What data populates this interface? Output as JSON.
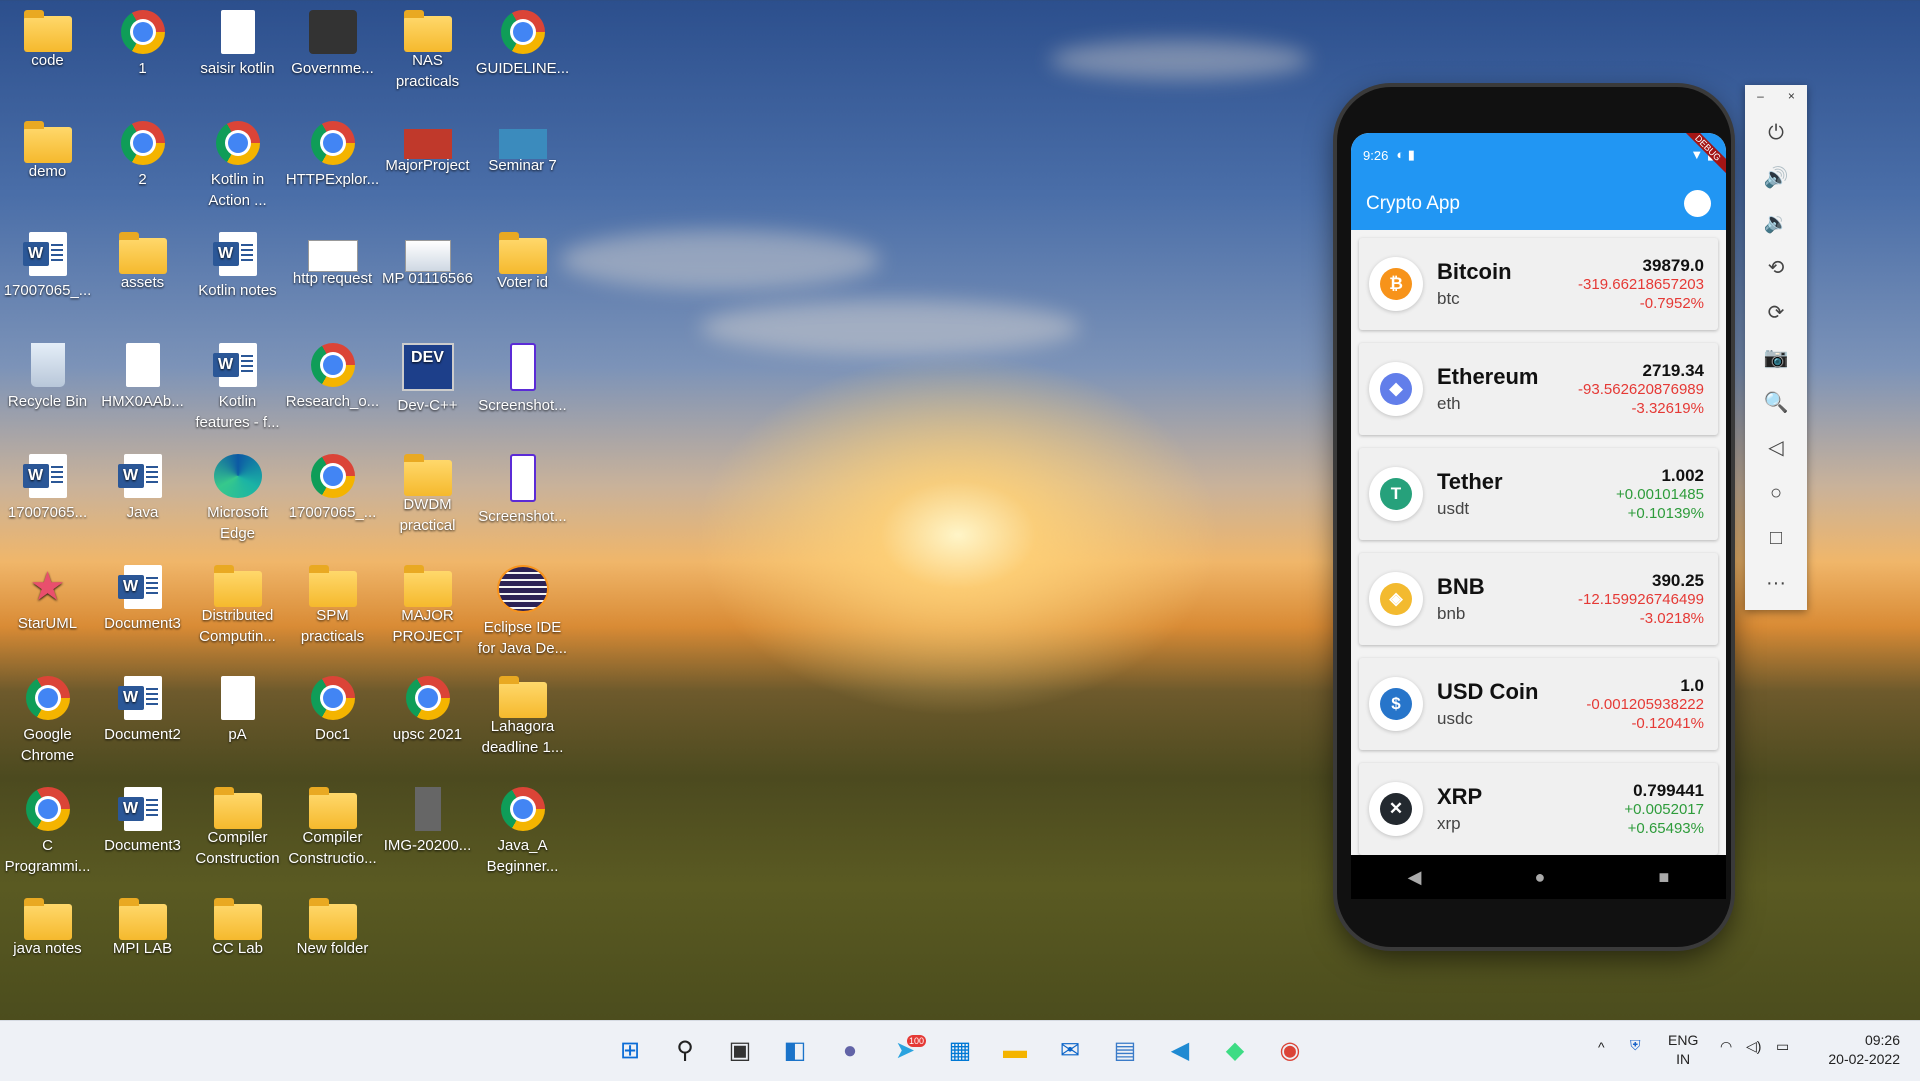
{
  "desktop": {
    "icons": [
      {
        "label": "code",
        "type": "folder"
      },
      {
        "label": "1",
        "type": "chrome"
      },
      {
        "label": "saisir kotlin",
        "type": "doc"
      },
      {
        "label": "Governme...",
        "type": "gov"
      },
      {
        "label": "NAS practicals",
        "type": "folder"
      },
      {
        "label": "GUIDELINE...",
        "type": "chrome"
      },
      {
        "label": "demo",
        "type": "folder"
      },
      {
        "label": "2",
        "type": "chrome"
      },
      {
        "label": "Kotlin in Action ...",
        "type": "chrome"
      },
      {
        "label": "HTTPExplor...",
        "type": "chrome"
      },
      {
        "label": "MajorProject",
        "type": "major"
      },
      {
        "label": "Seminar 7",
        "type": "seminar"
      },
      {
        "label": "17007065_...",
        "type": "word"
      },
      {
        "label": "assets",
        "type": "folder"
      },
      {
        "label": "Kotlin notes",
        "type": "word"
      },
      {
        "label": "http request",
        "type": "http"
      },
      {
        "label": "MP 01116566",
        "type": "img"
      },
      {
        "label": "Voter id",
        "type": "folder"
      },
      {
        "label": "Recycle Bin",
        "type": "bin"
      },
      {
        "label": "HMX0AAb...",
        "type": "doc"
      },
      {
        "label": "Kotlin features - f...",
        "type": "word"
      },
      {
        "label": "Research_o...",
        "type": "chrome"
      },
      {
        "label": "Dev-C++",
        "type": "dev"
      },
      {
        "label": "Screenshot...",
        "type": "phone"
      },
      {
        "label": "17007065...",
        "type": "word"
      },
      {
        "label": "Java",
        "type": "word"
      },
      {
        "label": "Microsoft Edge",
        "type": "edge"
      },
      {
        "label": "17007065_...",
        "type": "chrome"
      },
      {
        "label": "DWDM practical",
        "type": "folder"
      },
      {
        "label": "Screenshot...",
        "type": "phone"
      },
      {
        "label": "StarUML",
        "type": "star"
      },
      {
        "label": "Document3",
        "type": "word"
      },
      {
        "label": "Distributed Computin...",
        "type": "folder"
      },
      {
        "label": "SPM practicals",
        "type": "folder"
      },
      {
        "label": "MAJOR PROJECT",
        "type": "folder"
      },
      {
        "label": "Eclipse IDE for Java De...",
        "type": "eclipse"
      },
      {
        "label": "Google Chrome",
        "type": "chrome"
      },
      {
        "label": "Document2",
        "type": "word"
      },
      {
        "label": "pA",
        "type": "doc"
      },
      {
        "label": "Doc1",
        "type": "chrome"
      },
      {
        "label": "upsc 2021",
        "type": "chrome"
      },
      {
        "label": "Lahagora deadline 1...",
        "type": "folder"
      },
      {
        "label": "C Programmi...",
        "type": "chrome"
      },
      {
        "label": "Document3",
        "type": "word"
      },
      {
        "label": "Compiler Construction",
        "type": "folder"
      },
      {
        "label": "Compiler Constructio...",
        "type": "folder"
      },
      {
        "label": "IMG-20200...",
        "type": "dark"
      },
      {
        "label": "Java_A Beginner...",
        "type": "chrome"
      },
      {
        "label": "java notes",
        "type": "folder"
      },
      {
        "label": "MPI LAB",
        "type": "folder"
      },
      {
        "label": "CC Lab",
        "type": "folder"
      },
      {
        "label": "New folder",
        "type": "folder"
      }
    ]
  },
  "phone": {
    "status_time": "9:26",
    "debug_banner": "DEBUG",
    "app_title": "Crypto App",
    "coins": [
      {
        "name": "Bitcoin",
        "symbol": "btc",
        "price": "39879.0",
        "change": "-319.66218657203",
        "percent": "-0.7952%",
        "trend": "neg",
        "icon": "bitcoin-icon",
        "color": "#f7931a",
        "glyph": "₿"
      },
      {
        "name": "Ethereum",
        "symbol": "eth",
        "price": "2719.34",
        "change": "-93.562620876989",
        "percent": "-3.32619%",
        "trend": "neg",
        "icon": "ethereum-icon",
        "color": "#627eea",
        "glyph": "◆"
      },
      {
        "name": "Tether",
        "symbol": "usdt",
        "price": "1.002",
        "change": "+0.00101485",
        "percent": "+0.10139%",
        "trend": "pos",
        "icon": "tether-icon",
        "color": "#26a17b",
        "glyph": "T"
      },
      {
        "name": "BNB",
        "symbol": "bnb",
        "price": "390.25",
        "change": "-12.159926746499",
        "percent": "-3.0218%",
        "trend": "neg",
        "icon": "bnb-icon",
        "color": "#f3ba2f",
        "glyph": "◈"
      },
      {
        "name": "USD Coin",
        "symbol": "usdc",
        "price": "1.0",
        "change": "-0.001205938222",
        "percent": "-0.12041%",
        "trend": "neg",
        "icon": "usdc-icon",
        "color": "#2775ca",
        "glyph": "$"
      },
      {
        "name": "XRP",
        "symbol": "xrp",
        "price": "0.799441",
        "change": "+0.0052017",
        "percent": "+0.65493%",
        "trend": "pos",
        "icon": "xrp-icon",
        "color": "#23292f",
        "glyph": "✕"
      }
    ],
    "nav": {
      "back": "◀",
      "home": "●",
      "recents": "■"
    }
  },
  "emulator_toolbar": {
    "minimize": "–",
    "close": "×",
    "buttons": [
      {
        "name": "power-icon",
        "glyph": "⏻"
      },
      {
        "name": "volume-up-icon",
        "glyph": "🔊"
      },
      {
        "name": "volume-down-icon",
        "glyph": "🔉"
      },
      {
        "name": "rotate-left-icon",
        "glyph": "⟲"
      },
      {
        "name": "rotate-right-icon",
        "glyph": "⟳"
      },
      {
        "name": "camera-icon",
        "glyph": "📷"
      },
      {
        "name": "zoom-icon",
        "glyph": "🔍"
      },
      {
        "name": "back-icon",
        "glyph": "◁"
      },
      {
        "name": "home-icon",
        "glyph": "○"
      },
      {
        "name": "overview-icon",
        "glyph": "□"
      },
      {
        "name": "more-icon",
        "glyph": "···"
      }
    ]
  },
  "taskbar": {
    "apps": [
      {
        "name": "start-icon",
        "glyph": "⊞",
        "color": "#0a6cd6"
      },
      {
        "name": "search-icon",
        "glyph": "⚲",
        "color": "#222"
      },
      {
        "name": "task-view-icon",
        "glyph": "▣",
        "color": "#333"
      },
      {
        "name": "widgets-icon",
        "glyph": "◧",
        "color": "#1a73c9"
      },
      {
        "name": "chat-icon",
        "glyph": "●",
        "color": "#6264a7"
      },
      {
        "name": "telegram-icon",
        "glyph": "➤",
        "color": "#2aa3df"
      },
      {
        "name": "store-icon",
        "glyph": "▦",
        "color": "#0078d4"
      },
      {
        "name": "file-explorer-icon",
        "glyph": "▬",
        "color": "#f4b400"
      },
      {
        "name": "mail-icon",
        "glyph": "✉",
        "color": "#0a64c8"
      },
      {
        "name": "photos-icon",
        "glyph": "▤",
        "color": "#3a7bc8"
      },
      {
        "name": "vscode-icon",
        "glyph": "◀",
        "color": "#1f8ad2"
      },
      {
        "name": "android-studio-icon",
        "glyph": "◆",
        "color": "#3ddc84"
      },
      {
        "name": "chrome-icon",
        "glyph": "◉",
        "color": "#db4437"
      }
    ],
    "telegram_badge": "100",
    "language": "ENG",
    "region": "IN",
    "time": "09:26",
    "date": "20-02-2022"
  }
}
